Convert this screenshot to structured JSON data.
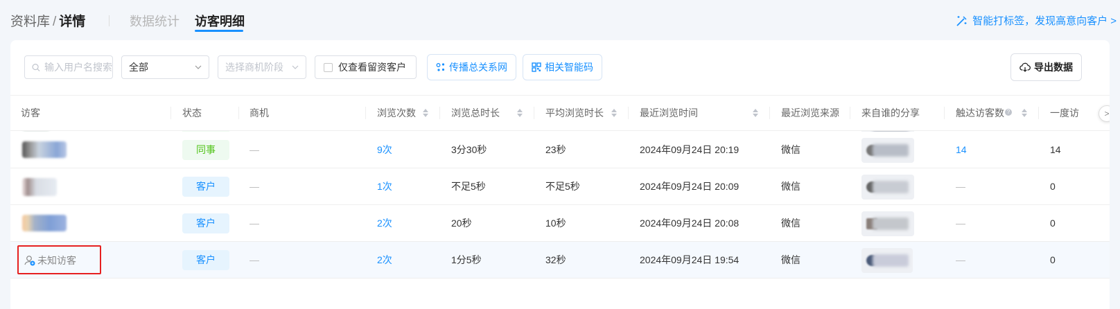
{
  "breadcrumb": {
    "library": "资料库",
    "sep": "/",
    "current": "详情"
  },
  "tabs": [
    {
      "label": "数据统计",
      "active": false
    },
    {
      "label": "访客明细",
      "active": true
    }
  ],
  "smart_tag_link": "智能打标签，发现高意向客户 >",
  "toolbar": {
    "search_placeholder": "输入用户名搜索",
    "type_select_value": "全部",
    "stage_select_placeholder": "选择商机阶段",
    "only_leads_label": "仅查看留资客户",
    "network_button": "传播总关系网",
    "smart_code_button": "相关智能码",
    "export_button": "导出数据"
  },
  "columns": [
    "访客",
    "状态",
    "商机",
    "浏览次数",
    "浏览总时长",
    "平均浏览时长",
    "最近浏览时间",
    "最近浏览来源",
    "来自谁的分享",
    "触达访客数",
    "一度访"
  ],
  "rows": [
    {
      "status": "同事",
      "status_type": "colleague",
      "opportunity": "—",
      "views": "9次",
      "total_time": "3分30秒",
      "avg_time": "23秒",
      "last_time": "2024年09月24日 20:19",
      "source": "微信",
      "reach": "14",
      "first_degree": "14"
    },
    {
      "status": "客户",
      "status_type": "customer",
      "opportunity": "—",
      "views": "1次",
      "total_time": "不足5秒",
      "avg_time": "不足5秒",
      "last_time": "2024年09月24日 20:09",
      "source": "微信",
      "reach": "—",
      "first_degree": "0"
    },
    {
      "status": "客户",
      "status_type": "customer",
      "opportunity": "—",
      "views": "2次",
      "total_time": "20秒",
      "avg_time": "10秒",
      "last_time": "2024年09月24日 20:08",
      "source": "微信",
      "reach": "—",
      "first_degree": "0"
    },
    {
      "visitor": "未知访客",
      "status": "客户",
      "status_type": "customer",
      "opportunity": "—",
      "views": "2次",
      "total_time": "1分5秒",
      "avg_time": "32秒",
      "last_time": "2024年09月24日 19:54",
      "source": "微信",
      "reach": "—",
      "first_degree": "0"
    }
  ],
  "colors": {
    "accent": "#1890ff",
    "colleague_green": "#52c41a",
    "highlight_red": "#e62020"
  }
}
